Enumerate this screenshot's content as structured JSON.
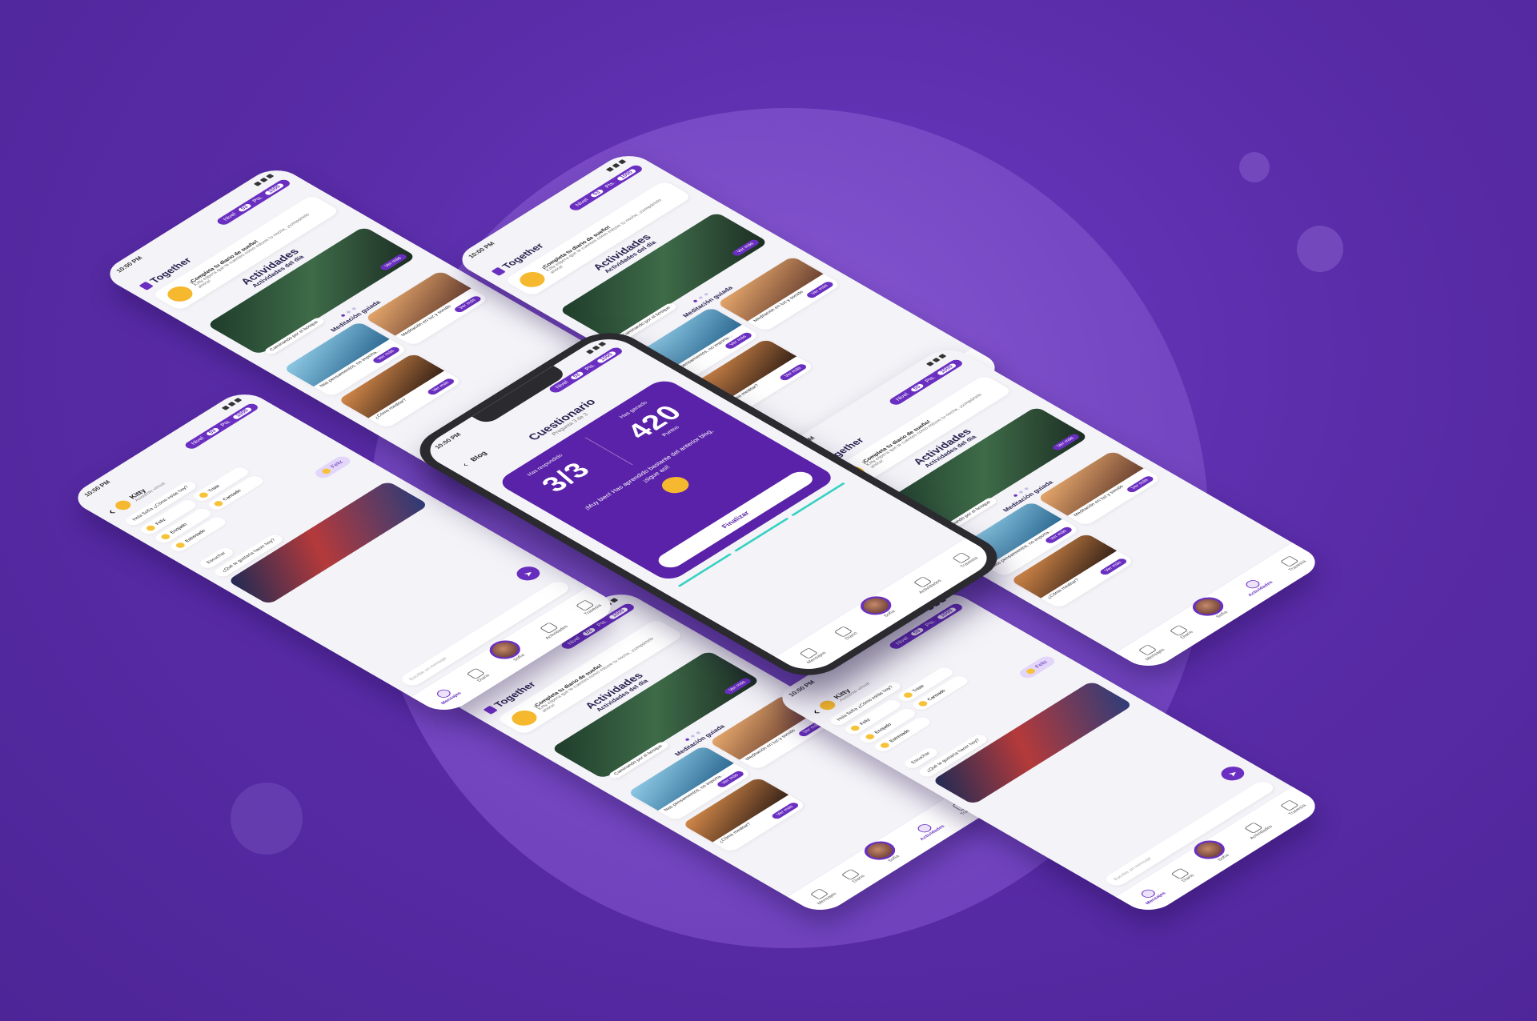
{
  "colors": {
    "accent": "#6a2fc0",
    "background": "#5a2ca8",
    "teal": "#36d2c2",
    "yellow": "#f5b82e"
  },
  "status": {
    "time": "10:00 PM"
  },
  "points_pill": {
    "level_label": "Nivel",
    "level_value": "53",
    "pts_label": "Pts.",
    "pts_value": "1000"
  },
  "brand": {
    "name": "Together"
  },
  "activities": {
    "notice_title": "¡Completa tu diario de sueño!",
    "notice_text": "Kitty espera que te cuentes como estuvo tu noche, ¡compártelo ahora!",
    "title": "Actividades",
    "subtitle": "Actividades del día",
    "hero_caption": "Caminando por el bosque",
    "hero_button": "Ver más",
    "meditation_title": "Meditación guiada",
    "cards": [
      {
        "caption": "Nos pensamientos, no importa…",
        "button": "Ver más"
      },
      {
        "caption": "Meditación en luz y sonido",
        "button": "Ver más"
      },
      {
        "caption": "¿Cómo meditar?",
        "button": "Ver más"
      },
      {
        "caption": "Nos pensamientos",
        "button": "Ver más"
      }
    ]
  },
  "chat": {
    "name": "Kitty",
    "role": "Asistente virtual",
    "greeting": "Hola Sofía ¿Cómo estás hoy?",
    "moods": [
      "Feliz",
      "Triste",
      "Enojado",
      "Cansado",
      "Estresado"
    ],
    "selected_mood": "Feliz",
    "question": "¿Qué te gustaría hacer hoy?",
    "answer": "Escuchar",
    "input_placeholder": "Escribe un mensaje"
  },
  "quiz": {
    "back_label": "Blog",
    "title": "Cuestionario",
    "subtitle": "Pregunta 3 de 3",
    "answered_label": "Has respondido",
    "answered_value": "3/3",
    "earned_label": "Has ganado",
    "earned_value": "420",
    "earned_unit": "Puntos",
    "message": "¡Muy bien! Has aprendido bastante del anterior blog, ¡sigue así!",
    "finish_button": "Finalizar"
  },
  "tabs": [
    {
      "label": "Mensajes",
      "icon": "chat-icon"
    },
    {
      "label": "Diario",
      "icon": "edit-icon"
    },
    {
      "label": "Sofía",
      "icon": "avatar"
    },
    {
      "label": "Actividades",
      "icon": "activities-icon"
    },
    {
      "label": "Travesía",
      "icon": "journey-icon"
    }
  ]
}
